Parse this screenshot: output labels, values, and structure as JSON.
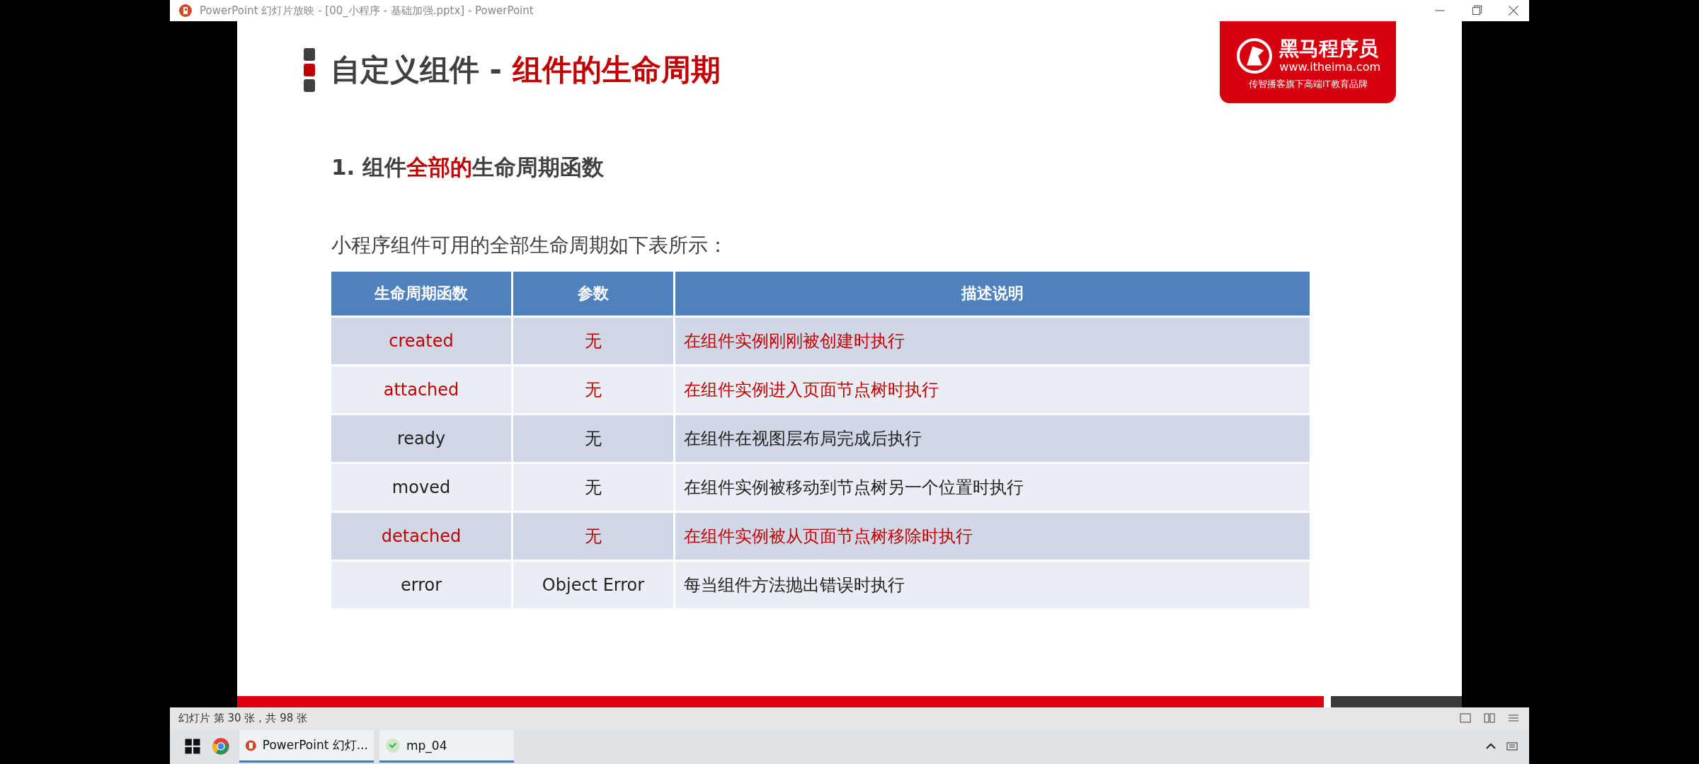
{
  "window": {
    "title": "PowerPoint 幻灯片放映 - [00_小程序 - 基础加强.pptx] - PowerPoint"
  },
  "slide": {
    "title_parts": [
      {
        "text": "自定义组件 - ",
        "highlight": false
      },
      {
        "text": "组件的生命周期",
        "highlight": true
      }
    ],
    "logo": {
      "name": "黑马程序员",
      "url": "www.itheima.com",
      "slogan": "传智播客旗下高端IT教育品牌"
    },
    "heading_parts": [
      {
        "text": "1. 组件",
        "highlight": false
      },
      {
        "text": "全部的",
        "highlight": true
      },
      {
        "text": "生命周期函数",
        "highlight": false
      }
    ],
    "intro": "小程序组件可用的全部生命周期如下表所示：",
    "table": {
      "columns": [
        "生命周期函数",
        "参数",
        "描述说明"
      ],
      "rows": [
        {
          "cells": [
            "created",
            "无",
            "在组件实例刚刚被创建时执行"
          ],
          "highlight": true
        },
        {
          "cells": [
            "attached",
            "无",
            "在组件实例进入页面节点树时执行"
          ],
          "highlight": true
        },
        {
          "cells": [
            "ready",
            "无",
            "在组件在视图层布局完成后执行"
          ],
          "highlight": false
        },
        {
          "cells": [
            "moved",
            "无",
            "在组件实例被移动到节点树另一个位置时执行"
          ],
          "highlight": false
        },
        {
          "cells": [
            "detached",
            "无",
            "在组件实例被从页面节点树移除时执行"
          ],
          "highlight": true
        },
        {
          "cells": [
            "error",
            "Object Error",
            "每当组件方法抛出错误时执行"
          ],
          "highlight": false
        }
      ]
    }
  },
  "status_bar": {
    "text": "幻灯片 第 30 张，共 98 张"
  },
  "taskbar": {
    "apps": [
      {
        "label": "PowerPoint 幻灯...",
        "kind": "powerpoint"
      },
      {
        "label": "mp_04",
        "kind": "explorer"
      }
    ]
  }
}
